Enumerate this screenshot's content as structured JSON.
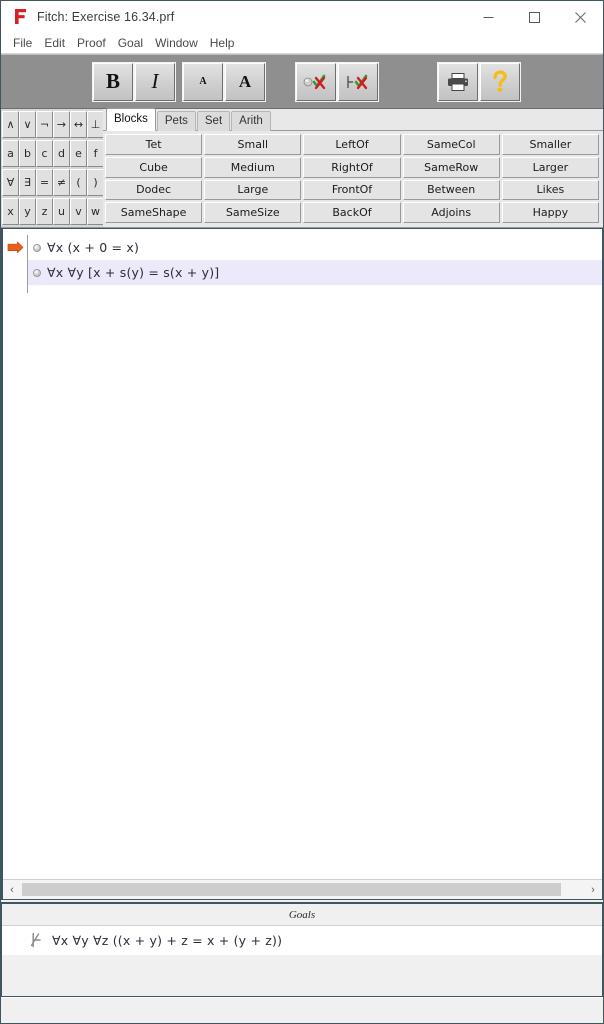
{
  "window": {
    "title": "Fitch: Exercise 16.34.prf",
    "logo_icon": "fitch-f-logo",
    "controls": [
      {
        "name": "minimize",
        "icon": "minimize-icon"
      },
      {
        "name": "maximize",
        "icon": "maximize-icon"
      },
      {
        "name": "close",
        "icon": "close-icon"
      }
    ]
  },
  "menubar": {
    "items": [
      {
        "label": "File"
      },
      {
        "label": "Edit"
      },
      {
        "label": "Proof"
      },
      {
        "label": "Goal"
      },
      {
        "label": "Window"
      },
      {
        "label": "Help"
      }
    ]
  },
  "toolbar": {
    "bold_label": "B",
    "italic_label": "I",
    "font_small_label": "A",
    "font_large_label": "A",
    "verify_sentence_icon": "verify-sentence-icon",
    "verify_proof_icon": "verify-proof-icon",
    "print_icon": "printer-icon",
    "help_icon": "help-question-icon"
  },
  "keypad": {
    "keys": [
      "∧",
      "∨",
      "¬",
      "→",
      "↔",
      "⊥",
      "a",
      "b",
      "c",
      "d",
      "e",
      "f",
      "∀",
      "∃",
      "=",
      "≠",
      "(",
      ")",
      "x",
      "y",
      "z",
      "u",
      "v",
      "w"
    ]
  },
  "predicate_panel": {
    "tabs": [
      {
        "label": "Blocks",
        "active": true
      },
      {
        "label": "Pets",
        "active": false
      },
      {
        "label": "Set",
        "active": false
      },
      {
        "label": "Arith",
        "active": false
      }
    ],
    "buttons": [
      "Tet",
      "Small",
      "LeftOf",
      "SameCol",
      "Smaller",
      "Cube",
      "Medium",
      "RightOf",
      "SameRow",
      "Larger",
      "Dodec",
      "Large",
      "FrontOf",
      "Between",
      "Likes",
      "SameShape",
      "SameSize",
      "BackOf",
      "Adjoins",
      "Happy"
    ]
  },
  "proof": {
    "focus_marker_icon": "orange-focus-arrow-icon",
    "lines": [
      {
        "formula": "∀x (x + 0 = x)",
        "highlight": false
      },
      {
        "formula": "∀x ∀y [x + s(y) = s(x + y)]",
        "highlight": true
      }
    ]
  },
  "scrollbar": {
    "left_arrow": "‹",
    "right_arrow": "›"
  },
  "goals": {
    "header": "Goals",
    "items": [
      {
        "icon": "not-entails-icon",
        "formula": "∀x ∀y ∀z ((x + y) + z = x + (y + z))"
      }
    ]
  },
  "colors": {
    "toolbar_bg": "#8f8f8f",
    "panel_bg": "#e8e8e8",
    "highlight_row": "#eceafa",
    "border": "#3f5560",
    "accent_orange": "#e8601c",
    "logo_red": "#d42026",
    "help_yellow": "#f2bd1d"
  }
}
